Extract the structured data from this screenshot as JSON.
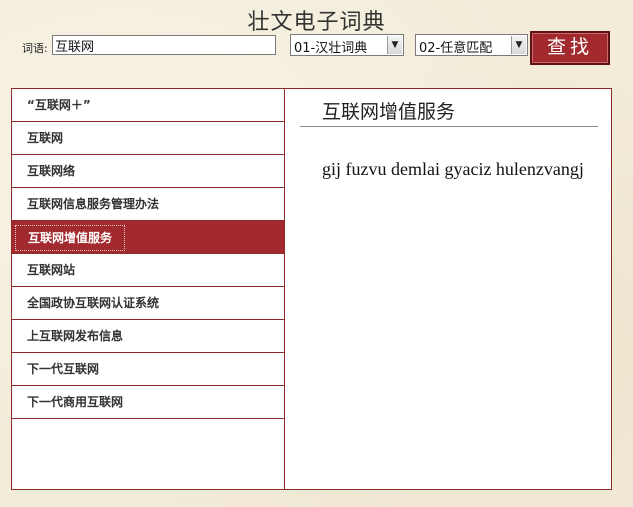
{
  "app": {
    "title": "壮文电子词典"
  },
  "search": {
    "label": "词语:",
    "value": "互联网"
  },
  "selects": {
    "dictionary": {
      "selected": "01-汉壮词典"
    },
    "match_mode": {
      "selected": "02-任意匹配"
    }
  },
  "search_button": {
    "label": "查找"
  },
  "word_list": {
    "items": [
      {
        "label": "“互联网＋”"
      },
      {
        "label": "互联网"
      },
      {
        "label": "互联网络"
      },
      {
        "label": "互联网信息服务管理办法"
      },
      {
        "label": "互联网增值服务"
      },
      {
        "label": "互联网站"
      },
      {
        "label": "全国政协互联网认证系统"
      },
      {
        "label": "上互联网发布信息"
      },
      {
        "label": "下一代互联网"
      },
      {
        "label": "下一代商用互联网"
      }
    ],
    "selected_index": 4
  },
  "detail": {
    "title": "互联网增值服务",
    "translation": "gij fuzvu demlai gyaciz hulenzvangj"
  },
  "colors": {
    "accent": "#a22a2e",
    "border": "#8f2a2a",
    "background": "#f3ecd9"
  }
}
